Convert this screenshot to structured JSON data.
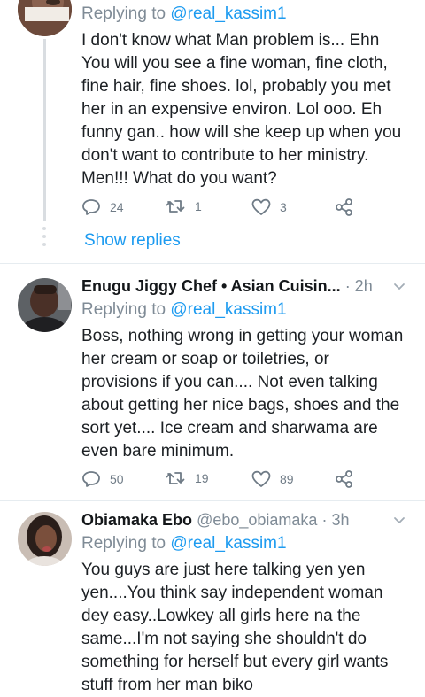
{
  "tweets": [
    {
      "name": "",
      "handle": "",
      "time": "",
      "replying_prefix": "Replying to",
      "replying_to": "@real_kassim1",
      "text": "I don't know what Man problem is... Ehn You will you see a fine woman, fine cloth, fine hair, fine shoes. lol, probably you met her in an expensive environ. Lol ooo. Eh funny gan.. how will she keep up when you don't want to contribute to her ministry. Men!!! What do you want?",
      "replies": "24",
      "retweets": "1",
      "likes": "3",
      "show_replies": "Show replies"
    },
    {
      "name": "Enugu Jiggy Chef • Asian Cuisin...",
      "handle": "",
      "time": "· 2h",
      "replying_prefix": "Replying to",
      "replying_to": "@real_kassim1",
      "text": "Boss, nothing wrong in getting your woman her cream or soap or toiletries, or provisions if you can.... Not even talking about getting her nice bags, shoes and the sort yet.... Ice cream and sharwama are even bare minimum.",
      "replies": "50",
      "retweets": "19",
      "likes": "89"
    },
    {
      "name": "Obiamaka Ebo",
      "handle": "@ebo_obiamaka",
      "time": "· 3h",
      "replying_prefix": "Replying to",
      "replying_to": "@real_kassim1",
      "text": "You guys are just here talking yen yen yen....You think say independent woman dey easy..Lowkey all girls here na the same...I'm not saying she shouldn't do something for herself but every girl wants stuff from her man biko"
    }
  ],
  "icons": {
    "reply": "speech-bubble-icon",
    "retweet": "retweet-icon",
    "like": "heart-icon",
    "share": "share-icon",
    "more": "chevron-down-icon"
  },
  "colors": {
    "link": "#1d9bf0",
    "secondary_text": "#7f8b96",
    "action_icon": "#6f7b86",
    "divider": "#e6ecf0"
  }
}
